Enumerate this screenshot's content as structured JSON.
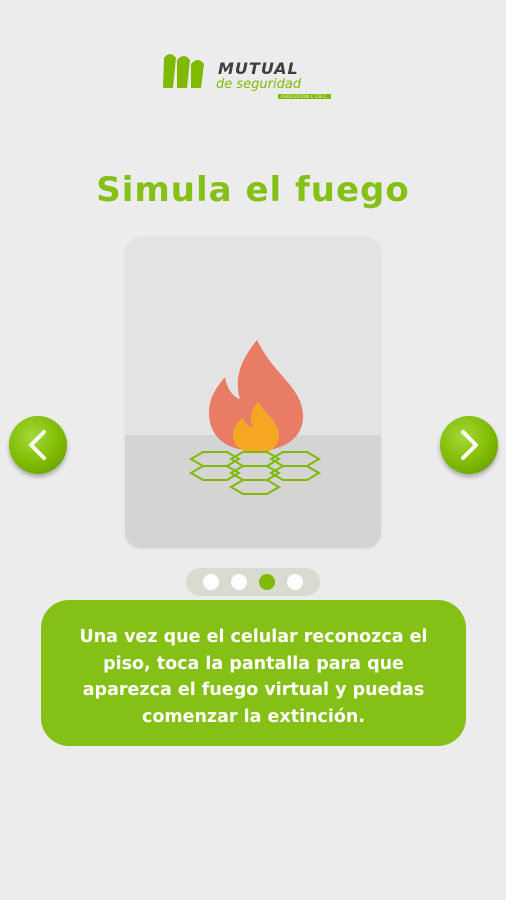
{
  "logo": {
    "brand": "MUTUAL",
    "subtitle": "de seguridad",
    "tagline": "ASOCIACIÓN C.CH.C."
  },
  "page": {
    "title": "Simula el fuego"
  },
  "illustration": {
    "icon": "fire-on-hexagon-floor-icon"
  },
  "navigation": {
    "prev_icon": "chevron-left-icon",
    "next_icon": "chevron-right-icon"
  },
  "pagination": {
    "total": 4,
    "active_index": 2
  },
  "info": {
    "text": "Una vez que el celular reconozca el piso, toca la pantalla para que aparezca el fuego virtual y puedas comenzar la extinción."
  },
  "colors": {
    "accent": "#85c017",
    "background": "#ececec",
    "flame_outer": "#e8735a",
    "flame_inner": "#f5a623"
  }
}
